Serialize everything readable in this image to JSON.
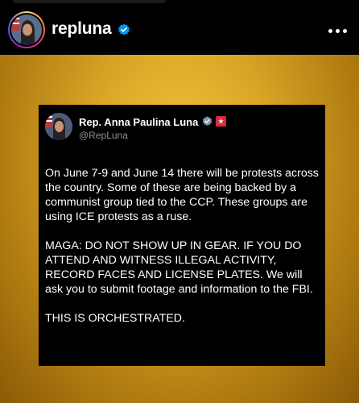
{
  "profile": {
    "username": "repluna",
    "icons": {
      "verified": "verified-badge-icon",
      "more": "more-options-icon"
    }
  },
  "post": {
    "background_colors": [
      "#f3c33c",
      "#b17d12"
    ],
    "tweet": {
      "display_name": "Rep. Anna Paulina Luna",
      "handle": "@RepLuna",
      "paragraphs": [
        "On June 7-9 and June 14 there will be protests across the country. Some of these are being backed by a communist group tied to the CCP. These groups are using ICE protests as a ruse.",
        "MAGA: DO NOT SHOW UP IN GEAR. IF YOU DO ATTEND AND WITNESS ILLEGAL ACTIVITY, RECORD FACES AND LICENSE PLATES. We will ask you to submit footage and information to the FBI.",
        "THIS IS ORCHESTRATED."
      ],
      "icons": {
        "verified": "gray-verified-badge-icon",
        "affiliate": "government-flag-icon"
      }
    }
  },
  "colors": {
    "verified_blue": "#0095f6",
    "gray_badge": "#829aab",
    "handle_gray": "#8b8f95"
  }
}
